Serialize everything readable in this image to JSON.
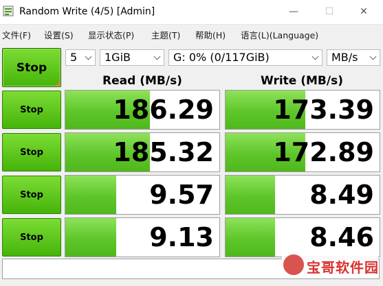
{
  "window": {
    "title": "Random Write (4/5) [Admin]",
    "minimize": "—",
    "maximize": "☐",
    "close": "✕"
  },
  "menu": [
    "文件(F)",
    "设置(S)",
    "显示状态(P)",
    "主题(T)",
    "帮助(H)",
    "语言(L)(Language)"
  ],
  "controls": {
    "main_button": "Stop",
    "count": "5",
    "size": "1GiB",
    "drive": "G: 0% (0/117GiB)",
    "unit": "MB/s"
  },
  "headers": {
    "read": "Read (MB/s)",
    "write": "Write (MB/s)"
  },
  "rows": [
    {
      "button": "Stop",
      "read": "186.29",
      "write": "173.39",
      "read_level": 0.55,
      "write_level": 0.52
    },
    {
      "button": "Stop",
      "read": "185.32",
      "write": "172.89",
      "read_level": 0.55,
      "write_level": 0.52
    },
    {
      "button": "Stop",
      "read": "9.57",
      "write": "8.49",
      "read_level": 0.33,
      "write_level": 0.32
    },
    {
      "button": "Stop",
      "read": "9.13",
      "write": "8.46",
      "read_level": 0.33,
      "write_level": 0.32
    }
  ],
  "status": "",
  "watermark": "宝哥软件园",
  "colors": {
    "accent_green": "#5ec62a",
    "button_green": "#46b40a",
    "watermark_red": "#d9332f"
  }
}
